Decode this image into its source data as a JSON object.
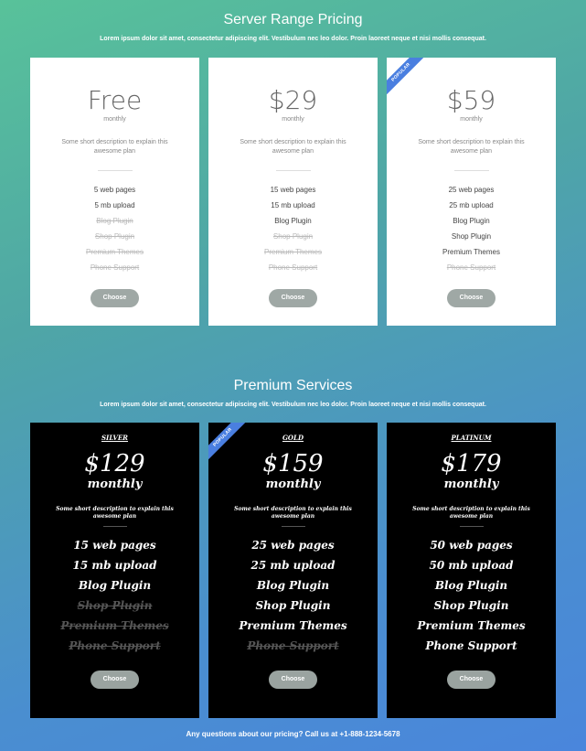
{
  "section1": {
    "title": "Server Range Pricing",
    "subtitle": "Lorem ipsum dolor sit amet, consectetur adipiscing elit. Vestibulum nec leo dolor. Proin laoreet neque et nisi mollis consequat.",
    "plans": [
      {
        "price": "Free",
        "period": "monthly",
        "popular": false,
        "description": "Some short description to explain this awesome plan",
        "features": [
          {
            "label": "5 web pages",
            "enabled": true
          },
          {
            "label": "5 mb upload",
            "enabled": true
          },
          {
            "label": "Blog Plugin",
            "enabled": false
          },
          {
            "label": "Shop Plugin",
            "enabled": false
          },
          {
            "label": "Premium Themes",
            "enabled": false
          },
          {
            "label": "Phone Support",
            "enabled": false
          }
        ],
        "button": "Choose"
      },
      {
        "price": "$29",
        "period": "monthly",
        "popular": false,
        "description": "Some short description to explain this awesome plan",
        "features": [
          {
            "label": "15 web pages",
            "enabled": true
          },
          {
            "label": "15 mb upload",
            "enabled": true
          },
          {
            "label": "Blog Plugin",
            "enabled": true
          },
          {
            "label": "Shop Plugin",
            "enabled": false
          },
          {
            "label": "Premium Themes",
            "enabled": false
          },
          {
            "label": "Phone Support",
            "enabled": false
          }
        ],
        "button": "Choose"
      },
      {
        "price": "$59",
        "period": "monthly",
        "popular": true,
        "ribbon": "POPULAR",
        "description": "Some short description to explain this awesome plan",
        "features": [
          {
            "label": "25 web pages",
            "enabled": true
          },
          {
            "label": "25 mb upload",
            "enabled": true
          },
          {
            "label": "Blog Plugin",
            "enabled": true
          },
          {
            "label": "Shop Plugin",
            "enabled": true
          },
          {
            "label": "Premium Themes",
            "enabled": true
          },
          {
            "label": "Phone Support",
            "enabled": false
          }
        ],
        "button": "Choose"
      }
    ]
  },
  "section2": {
    "title": "Premium Services",
    "subtitle": "Lorem ipsum dolor sit amet, consectetur adipiscing elit. Vestibulum nec leo dolor. Proin laoreet neque et nisi mollis consequat.",
    "plans": [
      {
        "tier": "SILVER",
        "price": "$129",
        "period": "monthly",
        "popular": false,
        "description": "Some short description to explain this awesome plan",
        "features": [
          {
            "label": "15 web pages",
            "enabled": true
          },
          {
            "label": "15 mb upload",
            "enabled": true
          },
          {
            "label": "Blog Plugin",
            "enabled": true
          },
          {
            "label": "Shop Plugin",
            "enabled": false
          },
          {
            "label": "Premium Themes",
            "enabled": false
          },
          {
            "label": "Phone Support",
            "enabled": false
          }
        ],
        "button": "Choose"
      },
      {
        "tier": "GOLD",
        "price": "$159",
        "period": "monthly",
        "popular": true,
        "ribbon": "POPULAR",
        "description": "Some short description to explain this awesome plan",
        "features": [
          {
            "label": "25 web pages",
            "enabled": true
          },
          {
            "label": "25 mb upload",
            "enabled": true
          },
          {
            "label": "Blog Plugin",
            "enabled": true
          },
          {
            "label": "Shop Plugin",
            "enabled": true
          },
          {
            "label": "Premium Themes",
            "enabled": true
          },
          {
            "label": "Phone Support",
            "enabled": false
          }
        ],
        "button": "Choose"
      },
      {
        "tier": "PLATINUM",
        "price": "$179",
        "period": "monthly",
        "popular": false,
        "description": "Some short description to explain this awesome plan",
        "features": [
          {
            "label": "50 web pages",
            "enabled": true
          },
          {
            "label": "50 mb upload",
            "enabled": true
          },
          {
            "label": "Blog Plugin",
            "enabled": true
          },
          {
            "label": "Shop Plugin",
            "enabled": true
          },
          {
            "label": "Premium Themes",
            "enabled": true
          },
          {
            "label": "Phone Support",
            "enabled": true
          }
        ],
        "button": "Choose"
      }
    ]
  },
  "footer": "Any questions about our pricing? Call us at +1-888-1234-5678",
  "colors": {
    "ribbon": "#4a7fe0",
    "button": "#9fa8a5",
    "disabled_light": "#bbbbbb",
    "disabled_dark": "#555555"
  }
}
